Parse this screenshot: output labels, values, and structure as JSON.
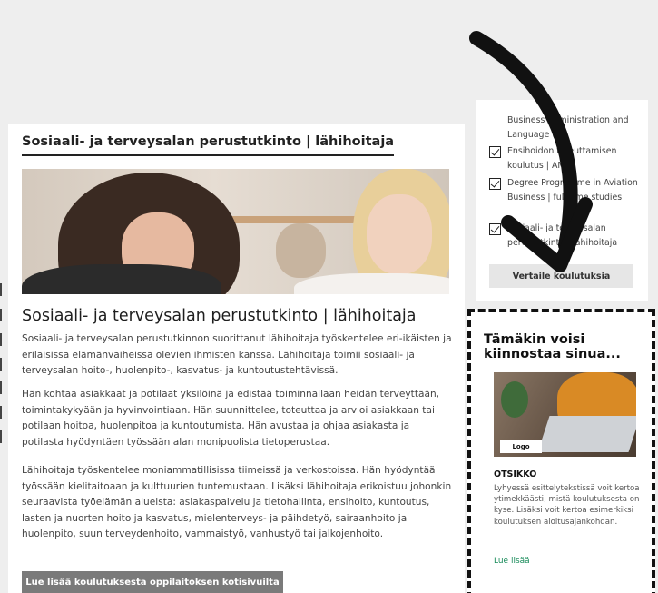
{
  "main": {
    "card_title": "Sosiaali- ja terveysalan perustutkinto | lähihoitaja",
    "body_title": "Sosiaali- ja terveysalan perustutkinto | lähihoitaja",
    "paragraph1": "Sosiaali- ja terveysalan perustutkinnon suorittanut lähihoitaja työskentelee eri-ikäisten ja erilaisissa elämänvaiheissa olevien ihmisten kanssa. Lähihoitaja toimii sosiaali- ja terveysalan hoito-, huolenpito-, kasvatus- ja kuntoutustehtävissä.",
    "paragraph2": "Hän kohtaa asiakkaat ja potilaat yksilöinä ja edistää toiminnallaan heidän terveyttään, toimintakykyään ja hyvinvointiaan. Hän suunnittelee, toteuttaa ja arvioi asiakkaan tai potilaan hoitoa, huolenpitoa ja kuntoutumista. Hän avustaa ja ohjaa asiakasta ja potilasta hyödyntäen työssään alan monipuolista tietoperustaa.",
    "paragraph3": "Lähihoitaja työskentelee moniammatillisissa tiimeissä ja verkostoissa. Hän hyödyntää työssään kielitaitoaan ja kulttuurien tuntemustaan. Lisäksi lähihoitaja erikoistuu johonkin seuraavista työelämän alueista: asiakaspalvelu ja tietohallinta, ensihoito, kuntoutus, lasten ja nuorten hoito ja kasvatus, mielenterveys- ja päihdetyö, sairaanhoito ja huolenpito, suun terveydenhoito, vammaistyö, vanhustyö tai jalkojenhoito.",
    "read_more_button": "Lue lisää koulutuksesta oppilaitoksen kotisivuilta"
  },
  "compare": {
    "items": [
      {
        "label": "Business Administration and Language (A)",
        "checked": false
      },
      {
        "label": "Ensihoidon toteuttamisen koulutus | AMK",
        "checked": true
      },
      {
        "label": "Degree Programme in Aviation Business | full-time studies",
        "checked": true
      },
      {
        "label": "Sosiaali- ja terveysalan perustutkinto | lähihoitaja",
        "checked": true
      }
    ],
    "button": "Vertaile koulutuksia"
  },
  "promo": {
    "title": "Tämäkin voisi kiinnostaa sinua...",
    "logo": "Logo",
    "heading": "OTSIKKO",
    "text": "Lyhyessä esittelytekstissä voit kertoa ytimekkäästi, mistä koulutuksesta on kyse. Lisäksi voit kertoa esimerkiksi koulutuksen aloitusajankohdan.",
    "link": "Lue lisää"
  },
  "colors": {
    "background": "#eeeeee",
    "card": "#ffffff",
    "button_gray": "#7a7a7a",
    "link_green": "#1a8c5b",
    "annotation_black": "#111111"
  },
  "icons": [
    "checkbox-checked-icon",
    "annotation-arrow-icon"
  ]
}
